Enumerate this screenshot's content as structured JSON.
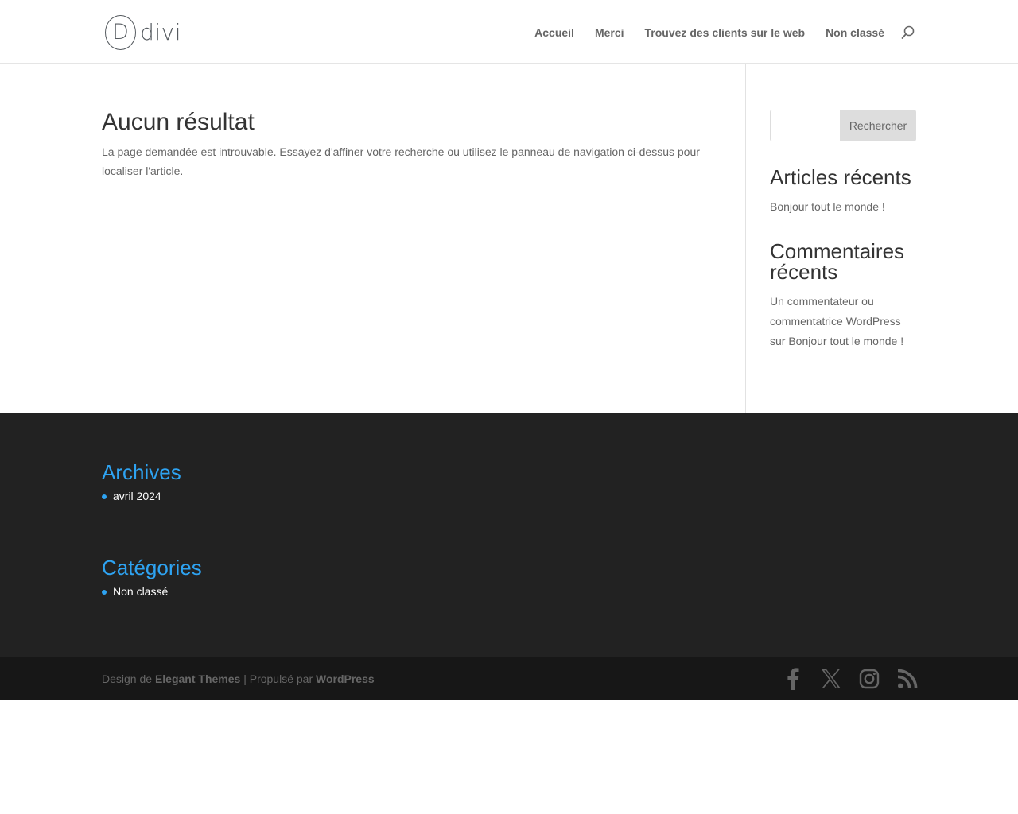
{
  "header": {
    "logo_word": "divi",
    "logo_letter": "D",
    "nav": [
      "Accueil",
      "Merci",
      "Trouvez des clients sur le web",
      "Non classé"
    ]
  },
  "main": {
    "title": "Aucun résultat",
    "message": "La page demandée est introuvable. Essayez d'affiner votre recherche ou utilisez le panneau de navigation ci-dessus pour localiser l'article."
  },
  "sidebar": {
    "search_button": "Rechercher",
    "search_value": "",
    "recent_posts_title": "Articles récents",
    "recent_posts": [
      "Bonjour tout le monde !"
    ],
    "recent_comments_title": "Commentaires récents",
    "comment_author": "Un commentateur ou commentatrice WordPress",
    "comment_joiner": "sur",
    "comment_post": "Bonjour tout le monde !"
  },
  "footer": {
    "archives_title": "Archives",
    "archives": [
      "avril 2024"
    ],
    "categories_title": "Catégories",
    "categories": [
      "Non classé"
    ],
    "credits_prefix": "Design de",
    "credits_theme": "Elegant Themes",
    "credits_separator": "| Propulsé par",
    "credits_platform": "WordPress",
    "social_icons": [
      "facebook-icon",
      "x-icon",
      "instagram-icon",
      "rss-icon"
    ]
  },
  "colors": {
    "accent": "#2ea3f2",
    "footer_bg": "#222222",
    "bottom_bar_bg": "#171717",
    "text": "#666666",
    "heading": "#333333"
  }
}
